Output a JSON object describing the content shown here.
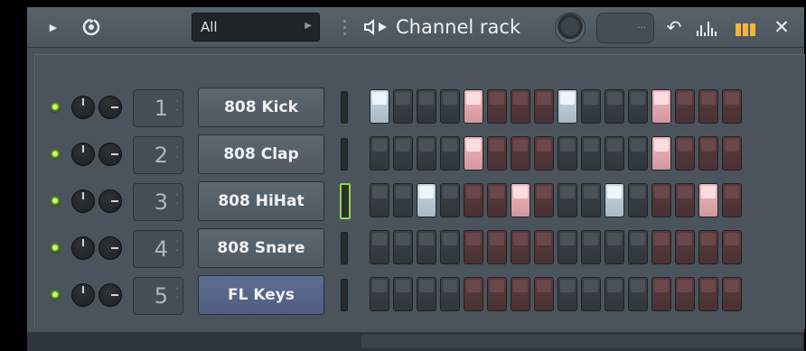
{
  "titlebar": {
    "filter_value": "All",
    "title": "Channel rack",
    "swing_value": "···"
  },
  "channels": [
    {
      "num": "1",
      "name": "808 Kick",
      "selected": false,
      "steps": [
        1,
        0,
        0,
        0,
        1,
        0,
        0,
        0,
        1,
        0,
        0,
        0,
        1,
        0,
        0,
        0
      ]
    },
    {
      "num": "2",
      "name": "808 Clap",
      "selected": false,
      "steps": [
        0,
        0,
        0,
        0,
        1,
        0,
        0,
        0,
        0,
        0,
        0,
        0,
        1,
        0,
        0,
        0
      ]
    },
    {
      "num": "3",
      "name": "808 HiHat",
      "selected": true,
      "steps": [
        0,
        0,
        1,
        0,
        0,
        0,
        1,
        0,
        0,
        0,
        1,
        0,
        0,
        0,
        1,
        0
      ]
    },
    {
      "num": "4",
      "name": "808 Snare",
      "selected": false,
      "steps": [
        0,
        0,
        0,
        0,
        0,
        0,
        0,
        0,
        0,
        0,
        0,
        0,
        0,
        0,
        0,
        0
      ]
    },
    {
      "num": "5",
      "name": "FL Keys",
      "selected": false,
      "highlighted": true,
      "steps": [
        0,
        0,
        0,
        0,
        0,
        0,
        0,
        0,
        0,
        0,
        0,
        0,
        0,
        0,
        0,
        0
      ]
    }
  ],
  "colors": {
    "led_on": "#8fd14a",
    "step_on_grey": "#dfe8ee",
    "step_on_red": "#f2c6cb",
    "selected_channel": "#56648a",
    "selected_meter": "#97d44a",
    "accent_orange": "#f3b53a"
  }
}
